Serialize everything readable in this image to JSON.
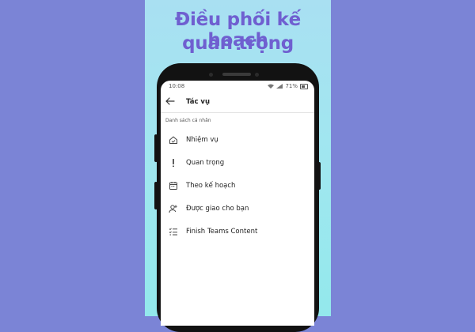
{
  "headline": {
    "line1": "Điều phối kế hoạch",
    "line2": "quan trọng"
  },
  "status_bar": {
    "time": "10:08",
    "battery": "71%"
  },
  "app_bar": {
    "title": "Tác vụ"
  },
  "section": {
    "label": "Danh sách cá nhân"
  },
  "lists": [
    {
      "label": "Nhiệm vụ",
      "icon": "home-icon"
    },
    {
      "label": "Quan trọng",
      "icon": "exclamation-icon"
    },
    {
      "label": "Theo kế hoạch",
      "icon": "calendar-icon"
    },
    {
      "label": "Được giao cho bạn",
      "icon": "assigned-user-icon"
    },
    {
      "label": "Finish Teams Content",
      "icon": "checklist-icon"
    }
  ],
  "colors": {
    "background": "#7b84d6",
    "panel": "#a9e0f2",
    "headline": "#6f5fd0",
    "phone_frame": "#121212"
  }
}
